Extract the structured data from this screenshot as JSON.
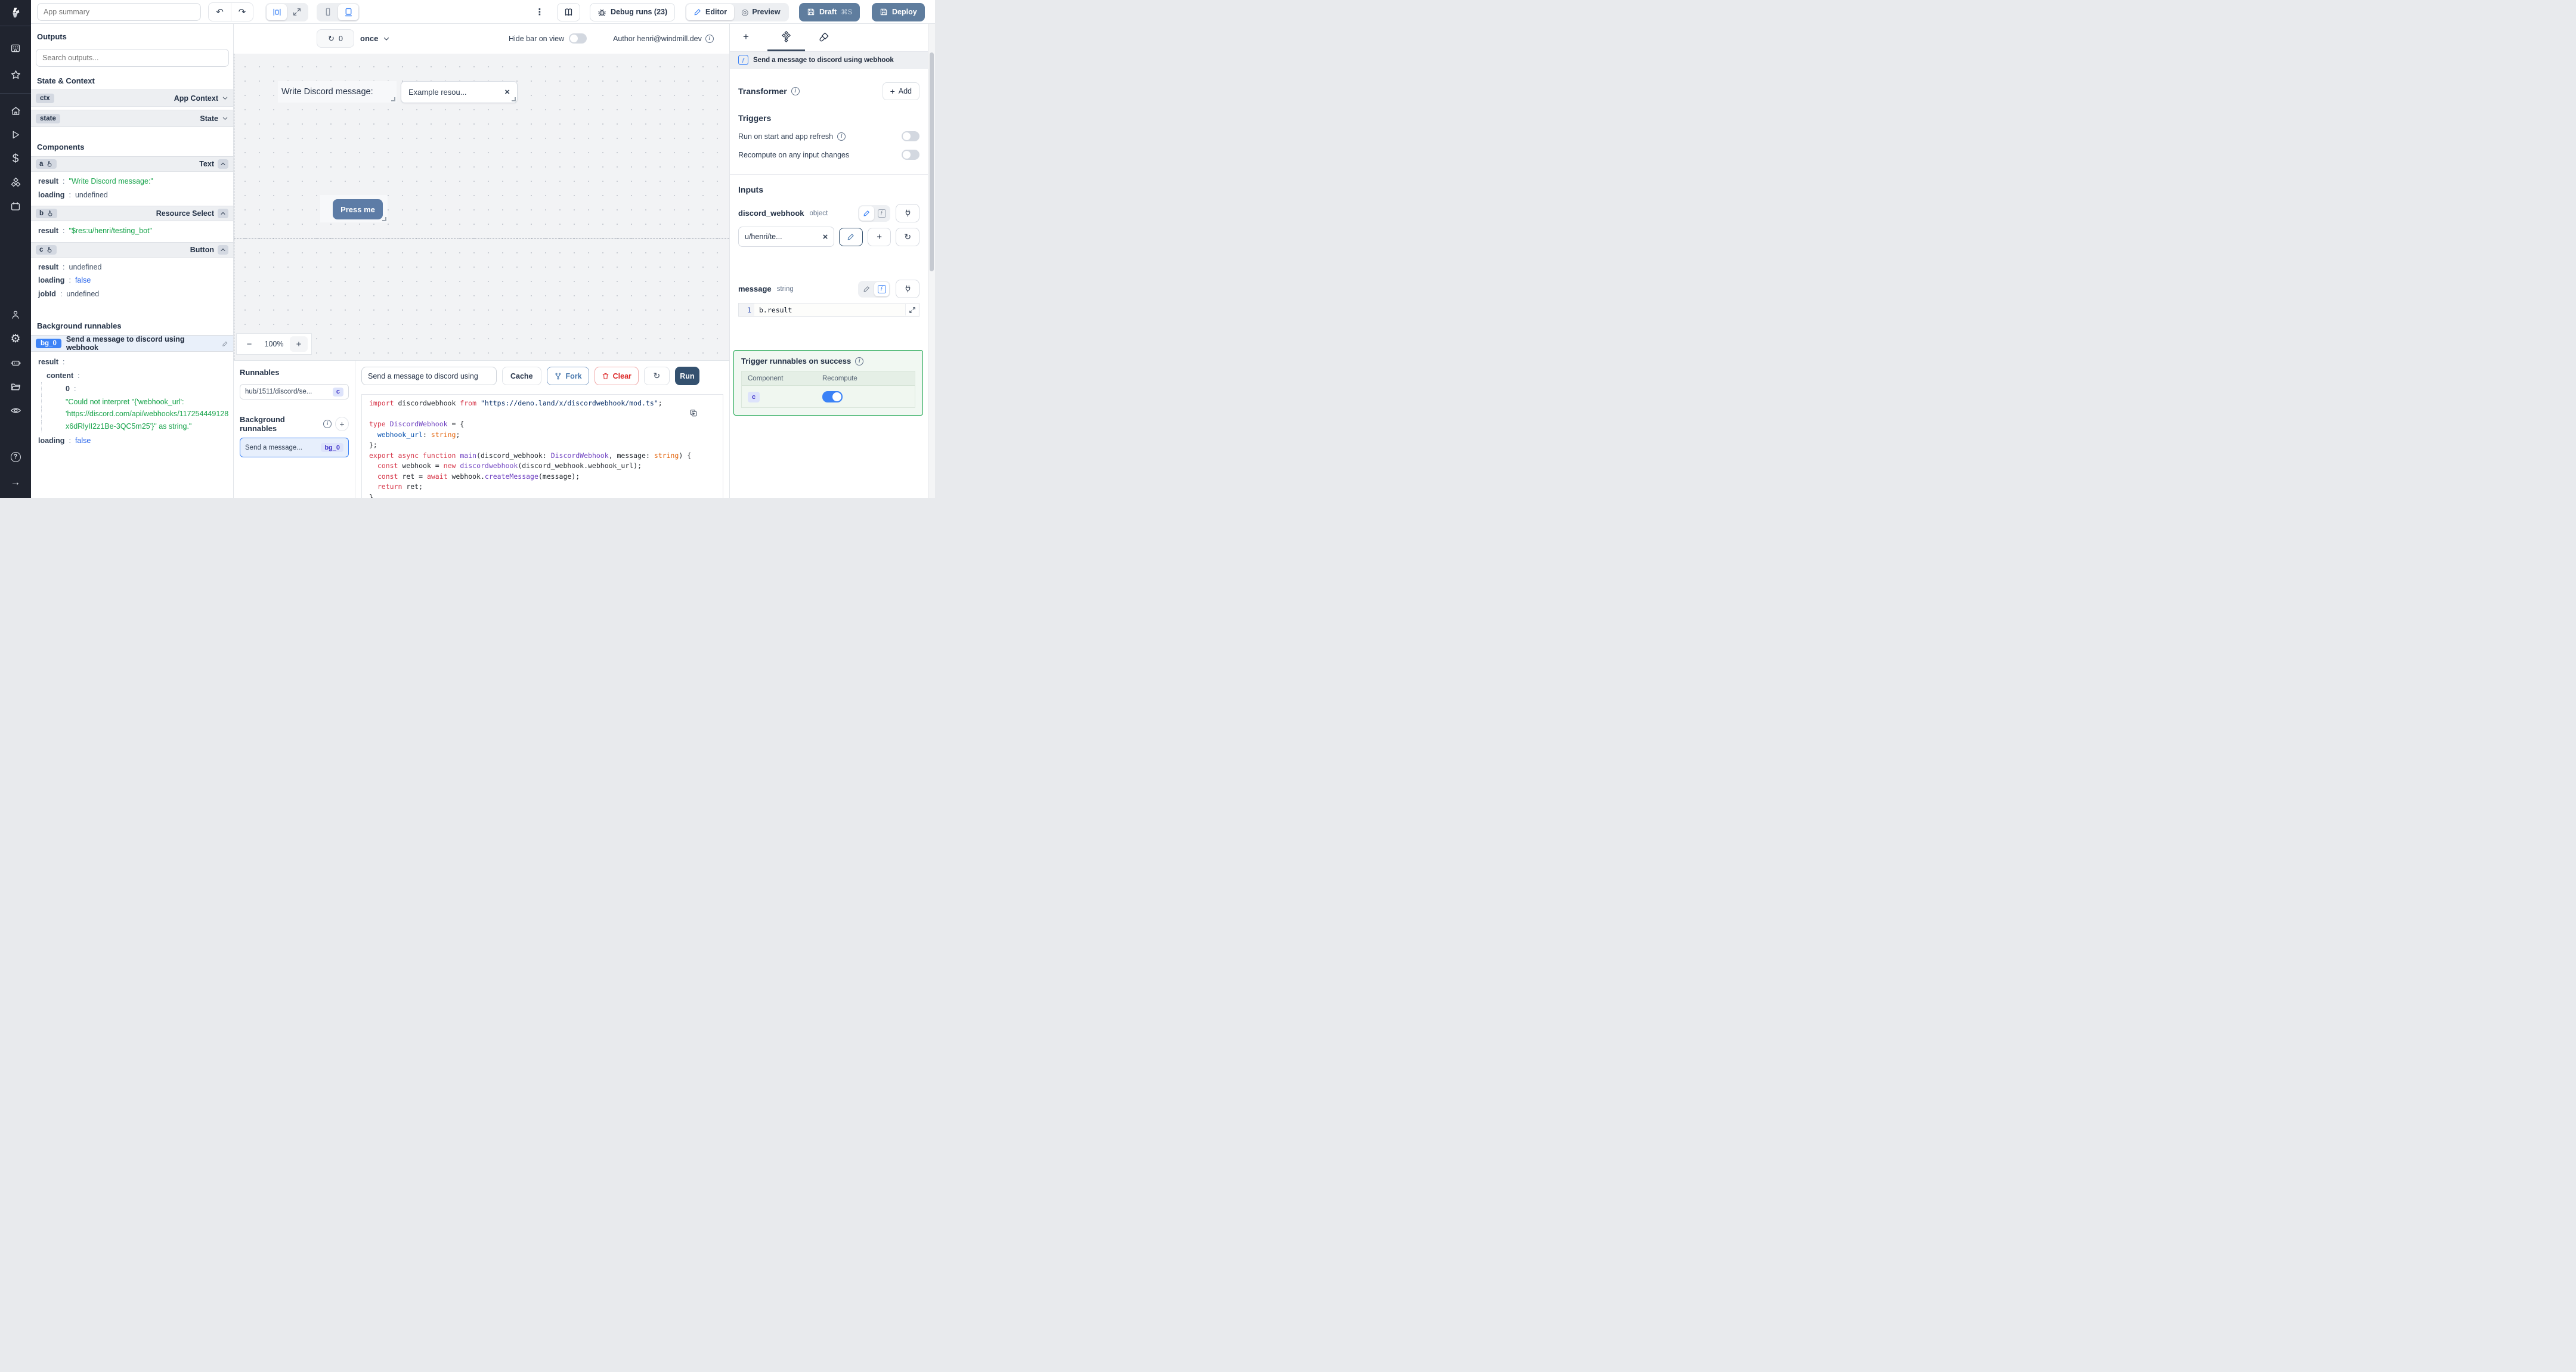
{
  "colors": {
    "accent_blue": "#3b82f6",
    "green": "#16a34a",
    "slate_button": "#5f7d9e",
    "run_button": "#34516f",
    "indigo_badge": "#4338ca",
    "red": "#dc2626"
  },
  "topbar": {
    "app_summary_placeholder": "App summary",
    "debug_runs": "Debug runs (23)",
    "editor": "Editor",
    "preview": "Preview",
    "draft": "Draft",
    "draft_shortcut": "⌘S",
    "deploy": "Deploy"
  },
  "canvas_toolbar": {
    "refresh_count": "0",
    "interval": "once",
    "hide_bar": "Hide bar on view",
    "author": "Author henri@windmill.dev"
  },
  "outputs": {
    "title": "Outputs",
    "search_placeholder": "Search outputs...",
    "state_context": "State & Context",
    "ctx_badge": "ctx",
    "ctx_label": "App Context",
    "state_badge": "state",
    "state_label": "State",
    "components_title": "Components",
    "comp_a": {
      "badge": "a",
      "type": "Text",
      "k1": "result",
      "v1": "\"Write Discord message:\"",
      "k2": "loading",
      "v2": "undefined"
    },
    "comp_b": {
      "badge": "b",
      "type": "Resource Select",
      "k1": "result",
      "v1": "\"$res:u/henri/testing_bot\""
    },
    "comp_c": {
      "badge": "c",
      "type": "Button",
      "k1": "result",
      "v1": "undefined",
      "k2": "loading",
      "v2": "false",
      "k3": "jobId",
      "v3": "undefined"
    },
    "background_title": "Background runnables",
    "bg_badge": "bg_0",
    "bg_label": "Send a message to discord using webhook",
    "bg_k_result": "result",
    "bg_k_content": "content",
    "bg_k_zero": "0",
    "bg_err_1": "\"Could not interpret \"{'webhook_url':",
    "bg_err_2": "'https://discord.com/api/webhooks/117254449128",
    "bg_err_3": "x6dRlyII2z1Be-3QC5m25'}\" as string.\"",
    "bg_k_loading": "loading",
    "bg_v_loading": "false"
  },
  "canvas": {
    "text_component": "Write Discord message:",
    "select_value": "Example resou...",
    "button_label": "Press me",
    "zoom": "100%"
  },
  "runnables": {
    "title": "Runnables",
    "item_label": "hub/1511/discord/se...",
    "item_badge": "c",
    "background_title": "Background runnables",
    "bg_label": "Send a message...",
    "bg_badge": "bg_0"
  },
  "editor": {
    "name": "Send a message to discord using",
    "cache": "Cache",
    "fork": "Fork",
    "clear": "Clear",
    "run": "Run",
    "code_lines": [
      [
        {
          "t": "import",
          "c": "k"
        },
        {
          "t": " discordwebhook ",
          "c": "p"
        },
        {
          "t": "from",
          "c": "k"
        },
        {
          "t": " ",
          "c": "p"
        },
        {
          "t": "\"https://deno.land/x/discordwebhook/mod.ts\"",
          "c": "s"
        },
        {
          "t": ";",
          "c": "p"
        }
      ],
      [],
      [
        {
          "t": "type",
          "c": "k"
        },
        {
          "t": " ",
          "c": "p"
        },
        {
          "t": "DiscordWebhook",
          "c": "ty"
        },
        {
          "t": " = {",
          "c": "p"
        }
      ],
      [
        {
          "t": "  ",
          "c": "p"
        },
        {
          "t": "webhook_url",
          "c": "pr"
        },
        {
          "t": ": ",
          "c": "p"
        },
        {
          "t": "string",
          "c": "o"
        },
        {
          "t": ";",
          "c": "p"
        }
      ],
      [
        {
          "t": "};",
          "c": "p"
        }
      ],
      [
        {
          "t": "export",
          "c": "k"
        },
        {
          "t": " ",
          "c": "p"
        },
        {
          "t": "async",
          "c": "k"
        },
        {
          "t": " ",
          "c": "p"
        },
        {
          "t": "function",
          "c": "k"
        },
        {
          "t": " ",
          "c": "p"
        },
        {
          "t": "main",
          "c": "fn"
        },
        {
          "t": "(discord_webhook: ",
          "c": "p"
        },
        {
          "t": "DiscordWebhook",
          "c": "ty"
        },
        {
          "t": ", message: ",
          "c": "p"
        },
        {
          "t": "string",
          "c": "o"
        },
        {
          "t": ") {",
          "c": "p"
        }
      ],
      [
        {
          "t": "  ",
          "c": "p"
        },
        {
          "t": "const",
          "c": "k"
        },
        {
          "t": " webhook = ",
          "c": "p"
        },
        {
          "t": "new",
          "c": "k"
        },
        {
          "t": " ",
          "c": "p"
        },
        {
          "t": "discordwebhook",
          "c": "ty"
        },
        {
          "t": "(discord_webhook.webhook_url);",
          "c": "p"
        }
      ],
      [
        {
          "t": "  ",
          "c": "p"
        },
        {
          "t": "const",
          "c": "k"
        },
        {
          "t": " ret = ",
          "c": "p"
        },
        {
          "t": "await",
          "c": "k"
        },
        {
          "t": " webhook.",
          "c": "p"
        },
        {
          "t": "createMessage",
          "c": "fn"
        },
        {
          "t": "(message);",
          "c": "p"
        }
      ],
      [
        {
          "t": "  ",
          "c": "p"
        },
        {
          "t": "return",
          "c": "k"
        },
        {
          "t": " ret;",
          "c": "p"
        }
      ],
      [
        {
          "t": "}",
          "c": "p"
        }
      ]
    ]
  },
  "inspector": {
    "header": "Send a message to discord using webhook",
    "transformer": "Transformer",
    "add": "Add",
    "triggers": "Triggers",
    "trigger_run": "Run on start and app refresh",
    "trigger_recompute": "Recompute on any input changes",
    "inputs": "Inputs",
    "dw_name": "discord_webhook",
    "dw_type": "object",
    "dw_value": "u/henri/te...",
    "msg_name": "message",
    "msg_type": "string",
    "msg_line": "1",
    "msg_code": "b.result",
    "ts_title": "Trigger runnables on success",
    "ts_col1": "Component",
    "ts_col2": "Recompute",
    "ts_badge": "c"
  }
}
